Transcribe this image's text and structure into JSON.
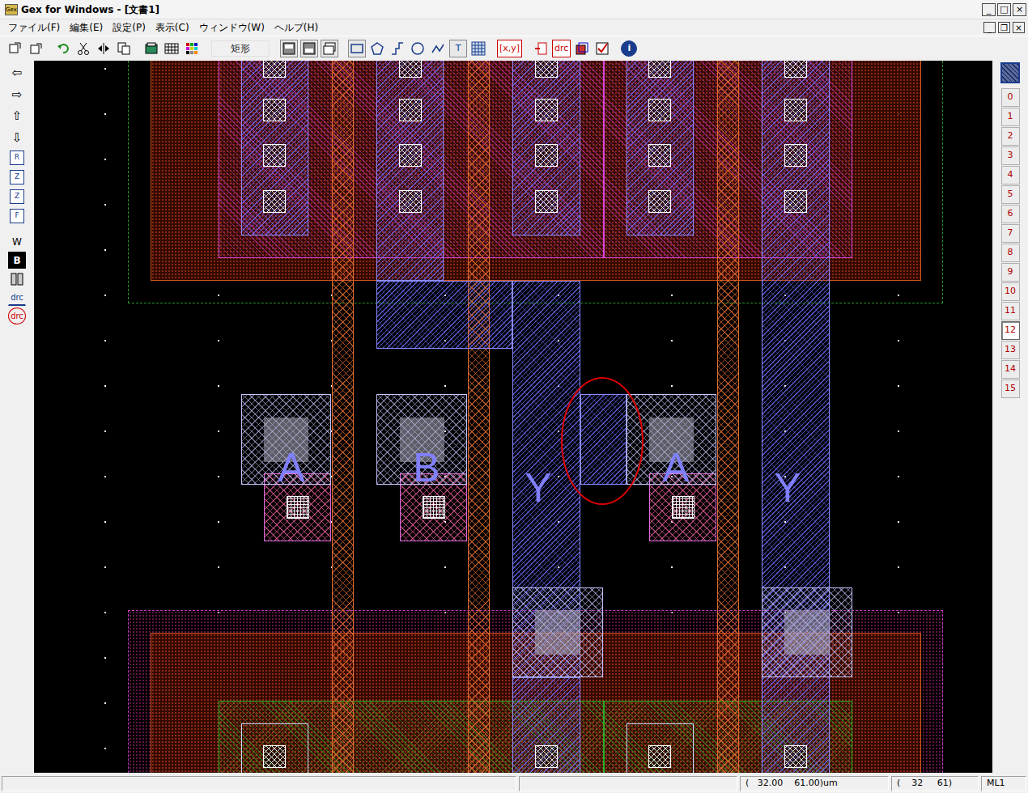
{
  "window": {
    "title": "Gex for Windows - [文書1]",
    "app_icon": "Gex",
    "controls": [
      "_",
      "□",
      "×"
    ]
  },
  "menu": {
    "items": [
      "ファイル(F)",
      "編集(E)",
      "設定(P)",
      "表示(C)",
      "ウィンドウ(W)",
      "ヘルプ(H)"
    ],
    "mdi_controls": [
      "_",
      "❐",
      "×"
    ]
  },
  "toolbar": {
    "shape_field": "矩形",
    "text_tool": "T",
    "xy": "[x,y]",
    "drc": "drc",
    "info": "i"
  },
  "left_tools": [
    {
      "label": "⇦",
      "kind": "glyph"
    },
    {
      "label": "⇨",
      "kind": "glyph"
    },
    {
      "label": "⇧",
      "kind": "glyph"
    },
    {
      "label": "⇩",
      "kind": "glyph"
    },
    {
      "label": "R",
      "kind": "boxed"
    },
    {
      "label": "Z",
      "kind": "boxed"
    },
    {
      "label": "Z",
      "kind": "boxed"
    },
    {
      "label": "F",
      "kind": "boxed"
    },
    {
      "label": "W",
      "kind": "plain"
    },
    {
      "label": "B",
      "kind": "dark"
    },
    {
      "label": "drc",
      "kind": "drc"
    },
    {
      "label": "drc",
      "kind": "nodrc"
    }
  ],
  "layers": [
    {
      "label": "0",
      "selected": false
    },
    {
      "label": "1",
      "selected": false
    },
    {
      "label": "2",
      "selected": false
    },
    {
      "label": "3",
      "selected": false
    },
    {
      "label": "4",
      "selected": false
    },
    {
      "label": "5",
      "selected": false
    },
    {
      "label": "6",
      "selected": false
    },
    {
      "label": "7",
      "selected": false
    },
    {
      "label": "8",
      "selected": false
    },
    {
      "label": "9",
      "selected": false
    },
    {
      "label": "10",
      "selected": false
    },
    {
      "label": "11",
      "selected": false
    },
    {
      "label": "12",
      "selected": true
    },
    {
      "label": "13",
      "selected": false
    },
    {
      "label": "14",
      "selected": false
    },
    {
      "label": "15",
      "selected": false
    }
  ],
  "canvas": {
    "labels": [
      {
        "text": "A"
      },
      {
        "text": "B"
      },
      {
        "text": "Y"
      },
      {
        "text": "A"
      },
      {
        "text": "Y"
      }
    ]
  },
  "status_bar": {
    "coords_um": "(   32.00    61.00)um",
    "coords_grid": "(    32     61)",
    "layer": "ML1"
  }
}
